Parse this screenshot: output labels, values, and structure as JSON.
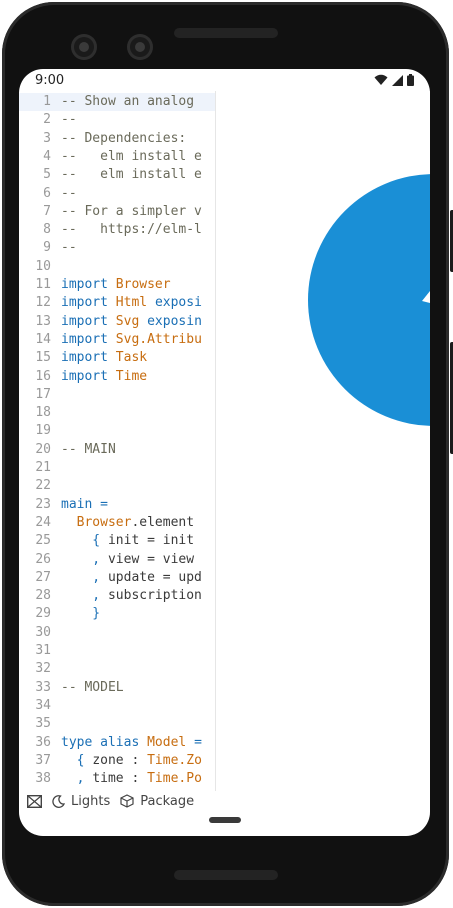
{
  "status": {
    "time": "9:00"
  },
  "editor": {
    "lines": [
      {
        "n": "1",
        "segs": [
          {
            "t": "-- Show an analog",
            "c": "comment"
          }
        ]
      },
      {
        "n": "2",
        "segs": [
          {
            "t": "--",
            "c": "comment"
          }
        ]
      },
      {
        "n": "3",
        "segs": [
          {
            "t": "-- Dependencies:",
            "c": "comment"
          }
        ]
      },
      {
        "n": "4",
        "segs": [
          {
            "t": "--   elm install e",
            "c": "comment"
          }
        ]
      },
      {
        "n": "5",
        "segs": [
          {
            "t": "--   elm install e",
            "c": "comment"
          }
        ]
      },
      {
        "n": "6",
        "segs": [
          {
            "t": "--",
            "c": "comment"
          }
        ]
      },
      {
        "n": "7",
        "segs": [
          {
            "t": "-- For a simpler v",
            "c": "comment"
          }
        ]
      },
      {
        "n": "8",
        "segs": [
          {
            "t": "--   https://elm-l",
            "c": "comment"
          }
        ]
      },
      {
        "n": "9",
        "segs": [
          {
            "t": "--",
            "c": "comment"
          }
        ]
      },
      {
        "n": "10",
        "segs": []
      },
      {
        "n": "11",
        "segs": [
          {
            "t": "import ",
            "c": "keyword"
          },
          {
            "t": "Browser",
            "c": "type"
          }
        ]
      },
      {
        "n": "12",
        "segs": [
          {
            "t": "import ",
            "c": "keyword"
          },
          {
            "t": "Html ",
            "c": "type"
          },
          {
            "t": "exposi",
            "c": "keyword"
          }
        ]
      },
      {
        "n": "13",
        "segs": [
          {
            "t": "import ",
            "c": "keyword"
          },
          {
            "t": "Svg ",
            "c": "type"
          },
          {
            "t": "exposin",
            "c": "keyword"
          }
        ]
      },
      {
        "n": "14",
        "segs": [
          {
            "t": "import ",
            "c": "keyword"
          },
          {
            "t": "Svg.Attribu",
            "c": "type"
          }
        ]
      },
      {
        "n": "15",
        "segs": [
          {
            "t": "import ",
            "c": "keyword"
          },
          {
            "t": "Task",
            "c": "type"
          }
        ]
      },
      {
        "n": "16",
        "segs": [
          {
            "t": "import ",
            "c": "keyword"
          },
          {
            "t": "Time",
            "c": "type"
          }
        ]
      },
      {
        "n": "17",
        "segs": []
      },
      {
        "n": "18",
        "segs": []
      },
      {
        "n": "19",
        "segs": []
      },
      {
        "n": "20",
        "segs": [
          {
            "t": "-- MAIN",
            "c": "comment"
          }
        ]
      },
      {
        "n": "21",
        "segs": []
      },
      {
        "n": "22",
        "segs": []
      },
      {
        "n": "23",
        "segs": [
          {
            "t": "main =",
            "c": "keyword"
          }
        ]
      },
      {
        "n": "24",
        "segs": [
          {
            "t": "  Browser",
            "c": "type"
          },
          {
            "t": ".element",
            "c": "default"
          }
        ]
      },
      {
        "n": "25",
        "segs": [
          {
            "t": "    { ",
            "c": "keyword"
          },
          {
            "t": "init = init",
            "c": "default"
          }
        ]
      },
      {
        "n": "26",
        "segs": [
          {
            "t": "    , ",
            "c": "keyword"
          },
          {
            "t": "view = view",
            "c": "default"
          }
        ]
      },
      {
        "n": "27",
        "segs": [
          {
            "t": "    , ",
            "c": "keyword"
          },
          {
            "t": "update = upd",
            "c": "default"
          }
        ]
      },
      {
        "n": "28",
        "segs": [
          {
            "t": "    , ",
            "c": "keyword"
          },
          {
            "t": "subscription",
            "c": "default"
          }
        ]
      },
      {
        "n": "29",
        "segs": [
          {
            "t": "    }",
            "c": "keyword"
          }
        ]
      },
      {
        "n": "30",
        "segs": []
      },
      {
        "n": "31",
        "segs": []
      },
      {
        "n": "32",
        "segs": []
      },
      {
        "n": "33",
        "segs": [
          {
            "t": "-- MODEL",
            "c": "comment"
          }
        ]
      },
      {
        "n": "34",
        "segs": []
      },
      {
        "n": "35",
        "segs": []
      },
      {
        "n": "36",
        "segs": [
          {
            "t": "type alias ",
            "c": "keyword"
          },
          {
            "t": "Model ",
            "c": "type"
          },
          {
            "t": "=",
            "c": "keyword"
          }
        ]
      },
      {
        "n": "37",
        "segs": [
          {
            "t": "  { ",
            "c": "keyword"
          },
          {
            "t": "zone : ",
            "c": "default"
          },
          {
            "t": "Time.Zo",
            "c": "type"
          }
        ]
      },
      {
        "n": "38",
        "segs": [
          {
            "t": "  , ",
            "c": "keyword"
          },
          {
            "t": "time : ",
            "c": "default"
          },
          {
            "t": "Time.Po",
            "c": "type"
          }
        ]
      }
    ]
  },
  "toolbar": {
    "lights_label": "Lights",
    "packages_label": "Package"
  },
  "colors": {
    "clock_face": "#1a8fd6",
    "comment": "#6a6a5a",
    "keyword": "#1a6fb5",
    "type": "#c76d10"
  },
  "icons": {
    "collapse": "collapse-icon",
    "lights": "moon-icon",
    "packages": "package-icon",
    "wifi": "wifi-icon",
    "signal": "signal-icon",
    "battery": "battery-icon"
  }
}
